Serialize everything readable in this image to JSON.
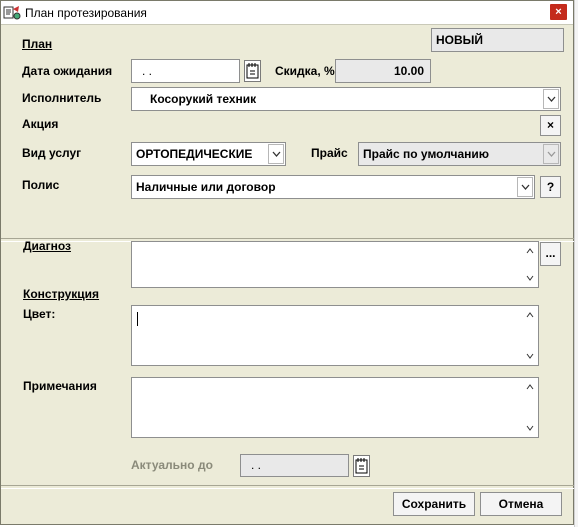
{
  "window": {
    "title": "План протезирования",
    "close_label": "×"
  },
  "status_field": {
    "value": "НОВЫЙ"
  },
  "labels": {
    "plan": "План",
    "date": "Дата ожидания",
    "discount": "Скидка, %",
    "executor": "Исполнитель",
    "promo": "Акция",
    "service_type": "Вид услуг",
    "price": "Прайс",
    "policy": "Полис",
    "diagnosis": "Диагноз",
    "construction": "Конструкция",
    "color": "Цвет:",
    "notes": "Примечания",
    "valid_until": "Актуально до"
  },
  "fields": {
    "date_value": ". .",
    "discount_value": "10.00",
    "executor_value": "Косорукий техник",
    "service_type_value": "ОРТОПЕДИЧЕСКИЕ",
    "price_value": "Прайс по умолчанию",
    "policy_value": "Наличные или договор",
    "valid_until_value": ". ."
  },
  "buttons": {
    "promo_clear": "×",
    "policy_help": "?",
    "diagnosis_more": "...",
    "save": "Сохранить",
    "cancel": "Отмена"
  }
}
